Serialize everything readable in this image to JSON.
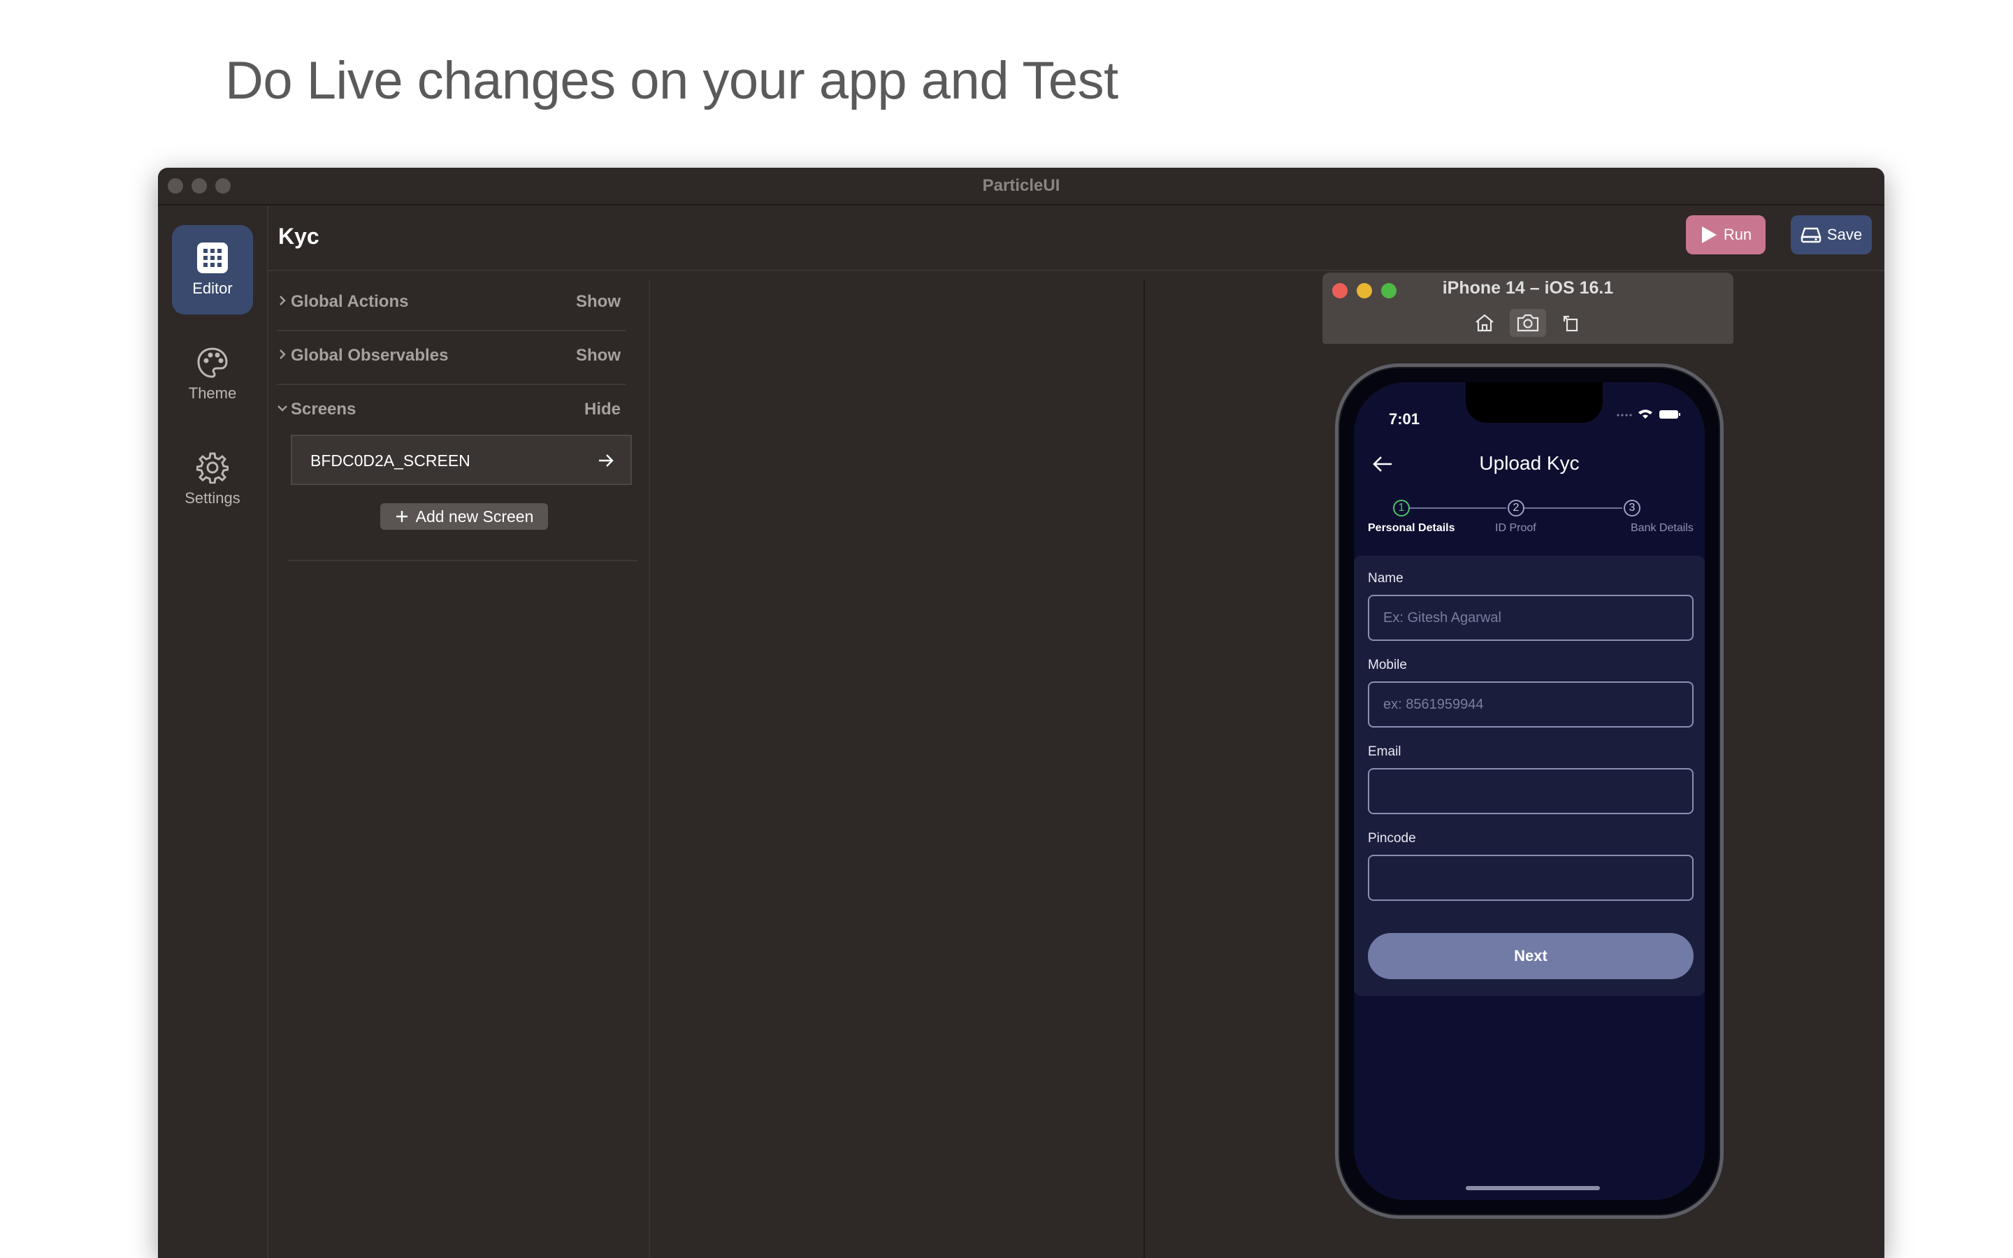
{
  "headline": "Do Live changes on your app and Test",
  "window": {
    "title": "ParticleUI"
  },
  "rail": [
    {
      "label": "Editor",
      "icon": "grid-icon",
      "active": true
    },
    {
      "label": "Theme",
      "icon": "palette-icon",
      "active": false
    },
    {
      "label": "Settings",
      "icon": "gear-icon",
      "active": false
    }
  ],
  "editor": {
    "title": "Kyc",
    "run_label": "Run",
    "save_label": "Save",
    "sections": [
      {
        "label": "Global Actions",
        "action": "Show"
      },
      {
        "label": "Global Observables",
        "action": "Show"
      },
      {
        "label": "Screens",
        "action": "Hide"
      }
    ],
    "screen_item": "BFDC0D2A_SCREEN",
    "add_screen_label": "Add new Screen"
  },
  "simulator": {
    "title": "iPhone 14 – iOS 16.1",
    "tools": [
      "home-icon",
      "screenshot-icon",
      "rotate-icon"
    ]
  },
  "phone": {
    "time": "7:01",
    "screen_title": "Upload Kyc",
    "steps": [
      {
        "number": "1",
        "label": "Personal Details",
        "active": true
      },
      {
        "number": "2",
        "label": "ID Proof",
        "active": false
      },
      {
        "number": "3",
        "label": "Bank Details",
        "active": false
      }
    ],
    "fields": [
      {
        "label": "Name",
        "placeholder": "Ex: Gitesh Agarwal"
      },
      {
        "label": "Mobile",
        "placeholder": "ex: 8561959944"
      },
      {
        "label": "Email",
        "placeholder": ""
      },
      {
        "label": "Pincode",
        "placeholder": ""
      }
    ],
    "next_label": "Next"
  },
  "colors": {
    "window_bg": "#2e2827",
    "run_button": "#c97690",
    "save_button": "#3c4c74",
    "active_rail": "#3a4a6e",
    "phone_screen": "#0e0f30",
    "next_button": "#727aa6",
    "step_done": "#4cc36a"
  }
}
